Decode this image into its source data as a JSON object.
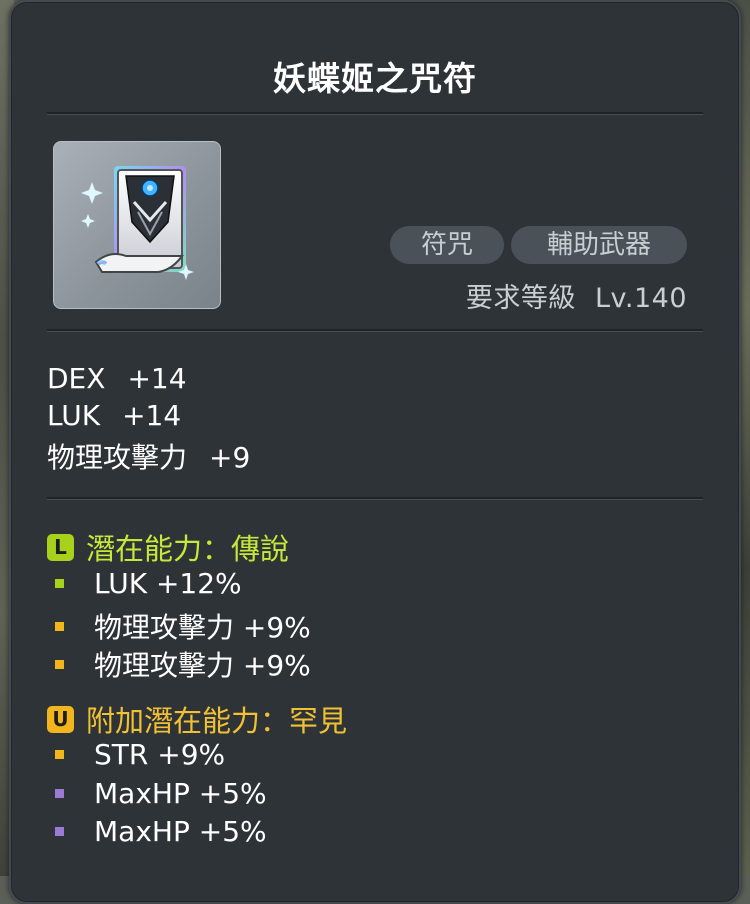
{
  "item": {
    "name": "妖蝶姬之咒符",
    "icon": "talisman-icon",
    "tags": [
      "符咒",
      "輔助武器"
    ],
    "required_level_label": "要求等級",
    "required_level_value": "Lv.140"
  },
  "stats": [
    {
      "name": "DEX",
      "value": "+14"
    },
    {
      "name": "LUK",
      "value": "+14"
    },
    {
      "name": "物理攻擊力",
      "value": "+9"
    }
  ],
  "potential": {
    "badge": "L",
    "header": "潛在能力：傳說",
    "color": "#c5e839",
    "lines": [
      {
        "text": "LUK +12%",
        "tier_color": "#a7d11b"
      },
      {
        "text": "物理攻擊力 +9%",
        "tier_color": "#f2b61c"
      },
      {
        "text": "物理攻擊力 +9%",
        "tier_color": "#f2b61c"
      }
    ]
  },
  "additional_potential": {
    "badge": "U",
    "header": "附加潛在能力：罕見",
    "color": "#f2c033",
    "lines": [
      {
        "text": "STR +9%",
        "tier_color": "#f2b61c"
      },
      {
        "text": "MaxHP +5%",
        "tier_color": "#9b7bd6"
      },
      {
        "text": "MaxHP +5%",
        "tier_color": "#9b7bd6"
      }
    ]
  }
}
